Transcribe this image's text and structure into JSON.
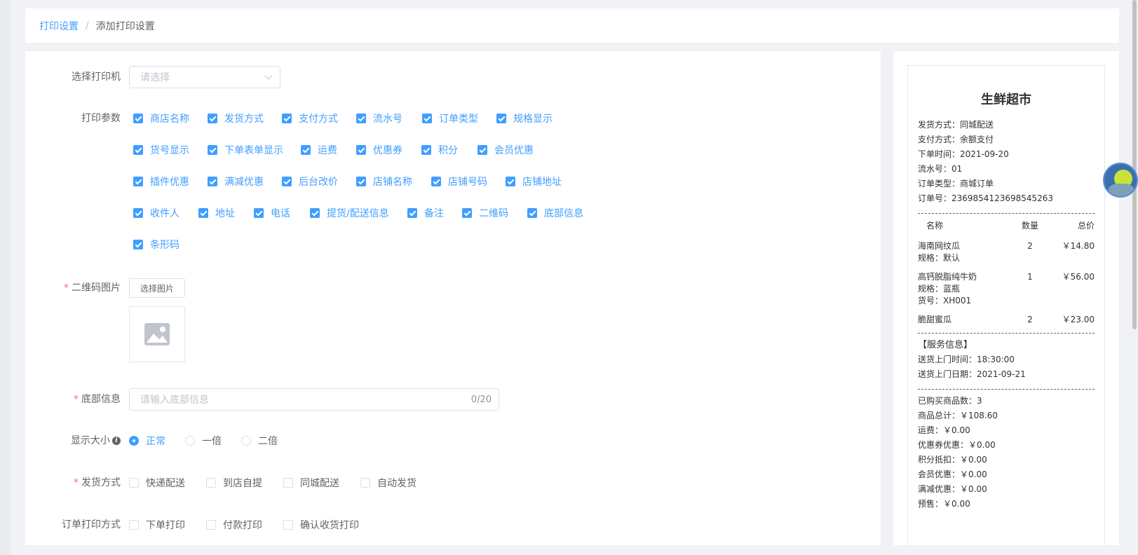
{
  "breadcrumb": {
    "parent": "打印设置",
    "separator": "/",
    "current": "添加打印设置"
  },
  "form": {
    "printer": {
      "label": "选择打印机",
      "placeholder": "请选择"
    },
    "params": {
      "label": "打印参数",
      "rows": [
        [
          "商店名称",
          "发货方式",
          "支付方式",
          "流水号",
          "订单类型",
          "规格显示"
        ],
        [
          "货号显示",
          "下单表单显示",
          "运费",
          "优惠券",
          "积分",
          "会员优惠"
        ],
        [
          "插件优惠",
          "满减优惠",
          "后台改价",
          "店铺名称",
          "店铺号码",
          "店铺地址"
        ],
        [
          "收件人",
          "地址",
          "电话",
          "提货/配送信息",
          "备注",
          "二维码",
          "底部信息"
        ],
        [
          "条形码"
        ]
      ]
    },
    "qrcode": {
      "label": "二维码图片",
      "button": "选择图片"
    },
    "footer_info": {
      "label": "底部信息",
      "placeholder": "请输入底部信息",
      "count": "0/20"
    },
    "display_size": {
      "label": "显示大小",
      "options": [
        "正常",
        "一倍",
        "二倍"
      ],
      "selected": "正常"
    },
    "shipping": {
      "label": "发货方式",
      "options": [
        "快递配送",
        "到店自提",
        "同城配送",
        "自动发货"
      ]
    },
    "order_print": {
      "label": "订单打印方式",
      "options": [
        "下单打印",
        "付款打印",
        "确认收货打印"
      ]
    }
  },
  "receipt": {
    "title": "生鲜超市",
    "info": [
      "发货方式：同城配送",
      "支付方式：余额支付",
      "下单时间：2021-09-20",
      "流水号：01",
      "订单类型：商城订单",
      "订单号：2369854123698545263"
    ],
    "columns": {
      "name": "名称",
      "qty": "数量",
      "total": "总价"
    },
    "items": [
      {
        "name": "海南网纹瓜",
        "lines": [
          "规格：默认"
        ],
        "qty": "2",
        "price": "￥14.80"
      },
      {
        "name": "高钙脱脂纯牛奶",
        "lines": [
          "规格：蓝瓶",
          "货号：XH001"
        ],
        "qty": "1",
        "price": "￥56.00"
      },
      {
        "name": "脆甜蜜瓜",
        "lines": [],
        "qty": "2",
        "price": "￥23.00"
      }
    ],
    "service": {
      "title": "【服务信息】",
      "lines": [
        "送货上门时间：18:30:00",
        "送货上门日期：2021-09-21"
      ]
    },
    "summary": [
      "已购买商品数：3",
      "商品总计：￥108.60",
      "运费：￥0.00",
      "优惠券优惠：￥0.00",
      "积分抵扣：￥0.00",
      "会员优惠：￥0.00",
      "满减优惠：￥0.00",
      "预售：￥0.00"
    ]
  }
}
